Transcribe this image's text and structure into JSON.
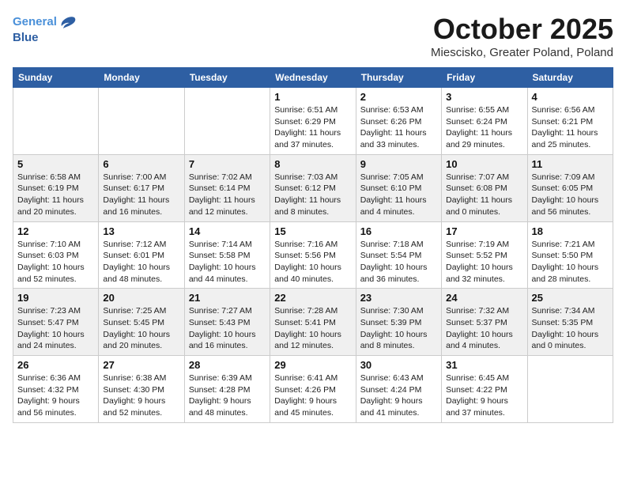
{
  "header": {
    "logo_line1": "General",
    "logo_line2": "Blue",
    "month_title": "October 2025",
    "location": "Miescisko, Greater Poland, Poland"
  },
  "weekdays": [
    "Sunday",
    "Monday",
    "Tuesday",
    "Wednesday",
    "Thursday",
    "Friday",
    "Saturday"
  ],
  "weeks": [
    {
      "shaded": false,
      "days": [
        {
          "num": "",
          "info": ""
        },
        {
          "num": "",
          "info": ""
        },
        {
          "num": "",
          "info": ""
        },
        {
          "num": "1",
          "info": "Sunrise: 6:51 AM\nSunset: 6:29 PM\nDaylight: 11 hours\nand 37 minutes."
        },
        {
          "num": "2",
          "info": "Sunrise: 6:53 AM\nSunset: 6:26 PM\nDaylight: 11 hours\nand 33 minutes."
        },
        {
          "num": "3",
          "info": "Sunrise: 6:55 AM\nSunset: 6:24 PM\nDaylight: 11 hours\nand 29 minutes."
        },
        {
          "num": "4",
          "info": "Sunrise: 6:56 AM\nSunset: 6:21 PM\nDaylight: 11 hours\nand 25 minutes."
        }
      ]
    },
    {
      "shaded": true,
      "days": [
        {
          "num": "5",
          "info": "Sunrise: 6:58 AM\nSunset: 6:19 PM\nDaylight: 11 hours\nand 20 minutes."
        },
        {
          "num": "6",
          "info": "Sunrise: 7:00 AM\nSunset: 6:17 PM\nDaylight: 11 hours\nand 16 minutes."
        },
        {
          "num": "7",
          "info": "Sunrise: 7:02 AM\nSunset: 6:14 PM\nDaylight: 11 hours\nand 12 minutes."
        },
        {
          "num": "8",
          "info": "Sunrise: 7:03 AM\nSunset: 6:12 PM\nDaylight: 11 hours\nand 8 minutes."
        },
        {
          "num": "9",
          "info": "Sunrise: 7:05 AM\nSunset: 6:10 PM\nDaylight: 11 hours\nand 4 minutes."
        },
        {
          "num": "10",
          "info": "Sunrise: 7:07 AM\nSunset: 6:08 PM\nDaylight: 11 hours\nand 0 minutes."
        },
        {
          "num": "11",
          "info": "Sunrise: 7:09 AM\nSunset: 6:05 PM\nDaylight: 10 hours\nand 56 minutes."
        }
      ]
    },
    {
      "shaded": false,
      "days": [
        {
          "num": "12",
          "info": "Sunrise: 7:10 AM\nSunset: 6:03 PM\nDaylight: 10 hours\nand 52 minutes."
        },
        {
          "num": "13",
          "info": "Sunrise: 7:12 AM\nSunset: 6:01 PM\nDaylight: 10 hours\nand 48 minutes."
        },
        {
          "num": "14",
          "info": "Sunrise: 7:14 AM\nSunset: 5:58 PM\nDaylight: 10 hours\nand 44 minutes."
        },
        {
          "num": "15",
          "info": "Sunrise: 7:16 AM\nSunset: 5:56 PM\nDaylight: 10 hours\nand 40 minutes."
        },
        {
          "num": "16",
          "info": "Sunrise: 7:18 AM\nSunset: 5:54 PM\nDaylight: 10 hours\nand 36 minutes."
        },
        {
          "num": "17",
          "info": "Sunrise: 7:19 AM\nSunset: 5:52 PM\nDaylight: 10 hours\nand 32 minutes."
        },
        {
          "num": "18",
          "info": "Sunrise: 7:21 AM\nSunset: 5:50 PM\nDaylight: 10 hours\nand 28 minutes."
        }
      ]
    },
    {
      "shaded": true,
      "days": [
        {
          "num": "19",
          "info": "Sunrise: 7:23 AM\nSunset: 5:47 PM\nDaylight: 10 hours\nand 24 minutes."
        },
        {
          "num": "20",
          "info": "Sunrise: 7:25 AM\nSunset: 5:45 PM\nDaylight: 10 hours\nand 20 minutes."
        },
        {
          "num": "21",
          "info": "Sunrise: 7:27 AM\nSunset: 5:43 PM\nDaylight: 10 hours\nand 16 minutes."
        },
        {
          "num": "22",
          "info": "Sunrise: 7:28 AM\nSunset: 5:41 PM\nDaylight: 10 hours\nand 12 minutes."
        },
        {
          "num": "23",
          "info": "Sunrise: 7:30 AM\nSunset: 5:39 PM\nDaylight: 10 hours\nand 8 minutes."
        },
        {
          "num": "24",
          "info": "Sunrise: 7:32 AM\nSunset: 5:37 PM\nDaylight: 10 hours\nand 4 minutes."
        },
        {
          "num": "25",
          "info": "Sunrise: 7:34 AM\nSunset: 5:35 PM\nDaylight: 10 hours\nand 0 minutes."
        }
      ]
    },
    {
      "shaded": false,
      "days": [
        {
          "num": "26",
          "info": "Sunrise: 6:36 AM\nSunset: 4:32 PM\nDaylight: 9 hours\nand 56 minutes."
        },
        {
          "num": "27",
          "info": "Sunrise: 6:38 AM\nSunset: 4:30 PM\nDaylight: 9 hours\nand 52 minutes."
        },
        {
          "num": "28",
          "info": "Sunrise: 6:39 AM\nSunset: 4:28 PM\nDaylight: 9 hours\nand 48 minutes."
        },
        {
          "num": "29",
          "info": "Sunrise: 6:41 AM\nSunset: 4:26 PM\nDaylight: 9 hours\nand 45 minutes."
        },
        {
          "num": "30",
          "info": "Sunrise: 6:43 AM\nSunset: 4:24 PM\nDaylight: 9 hours\nand 41 minutes."
        },
        {
          "num": "31",
          "info": "Sunrise: 6:45 AM\nSunset: 4:22 PM\nDaylight: 9 hours\nand 37 minutes."
        },
        {
          "num": "",
          "info": ""
        }
      ]
    }
  ]
}
